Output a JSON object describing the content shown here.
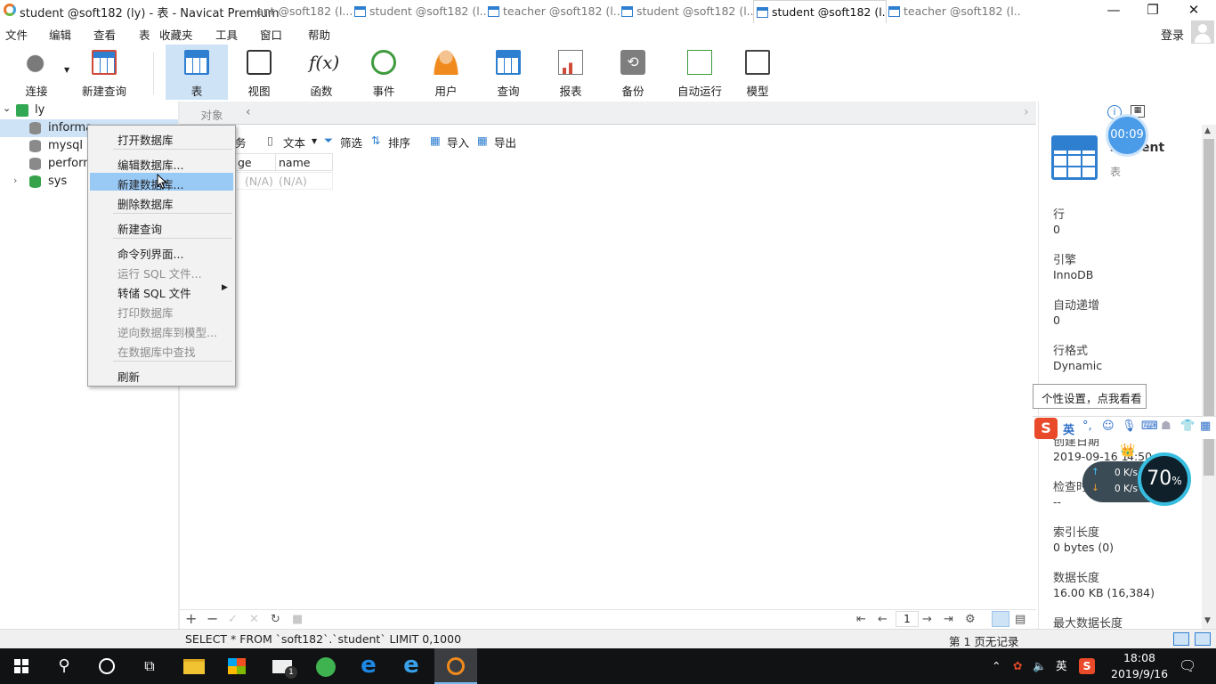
{
  "window": {
    "title": "student @soft182 (ly) - 表 - Navicat Premium"
  },
  "menubar": {
    "items": [
      "文件",
      "编辑",
      "查看",
      "表",
      "收藏夹",
      "工具",
      "窗口",
      "帮助"
    ],
    "login": "登录"
  },
  "toolbar": {
    "items": [
      "连接",
      "新建查询",
      "表",
      "视图",
      "函数",
      "事件",
      "用户",
      "查询",
      "报表",
      "备份",
      "自动运行",
      "模型"
    ]
  },
  "tree": {
    "connection": "ly",
    "databases": [
      "informa",
      "mysql",
      "perforn",
      "sys"
    ]
  },
  "tabs": {
    "objects": "对象",
    "items": [
      "ent @soft182 (l...",
      "student @soft182 (l...",
      "teacher @soft182 (l...",
      "student @soft182 (l...",
      "student @soft182 (l...",
      "teacher @soft182 (l..."
    ]
  },
  "subtoolbar": {
    "transaction": "务",
    "text": "文本",
    "filter": "筛选",
    "sort": "排序",
    "import": "导入",
    "export": "导出"
  },
  "grid": {
    "columns": [
      "ge",
      "name"
    ],
    "row": [
      "(N/A)",
      "(N/A)"
    ]
  },
  "context_menu": {
    "items": [
      "打开数据库",
      "编辑数据库...",
      "新建数据库...",
      "删除数据库",
      "新建查询",
      "命令列界面...",
      "运行 SQL 文件...",
      "转储 SQL 文件",
      "打印数据库",
      "逆向数据库到模型...",
      "在数据库中查找",
      "刷新"
    ]
  },
  "bottombar": {
    "page": "1"
  },
  "statusbar": {
    "sql": "SELECT * FROM `soft182`.`student` LIMIT 0,1000",
    "records": "第 1 页无记录"
  },
  "info_panel": {
    "name": "student",
    "type": "表",
    "fields": [
      {
        "label": "行",
        "value": "0"
      },
      {
        "label": "引擎",
        "value": "InnoDB"
      },
      {
        "label": "自动递增",
        "value": "0"
      },
      {
        "label": "行格式",
        "value": "Dynamic"
      },
      {
        "label": "创建日期",
        "value": "2019-09-16 1"
      },
      {
        "label": "检查时",
        "value": "--"
      },
      {
        "label": "索引长度",
        "value": "0 bytes (0)"
      },
      {
        "label": "数据长度",
        "value": "16.00 KB (16,384)"
      },
      {
        "label": "最大数据长度",
        "value": ""
      }
    ]
  },
  "overlay": {
    "timer": "00:09",
    "tooltip": "个性设置，点我看看",
    "ime_lang": "英",
    "created_tail": "4:50",
    "net_up": "0 K/s",
    "net_down": "0 K/s",
    "gauge_value": "70",
    "gauge_unit": "%"
  },
  "taskbar": {
    "tray_lang": "英",
    "time": "18:08",
    "date": "2019/9/16",
    "mail_badge": "1"
  }
}
